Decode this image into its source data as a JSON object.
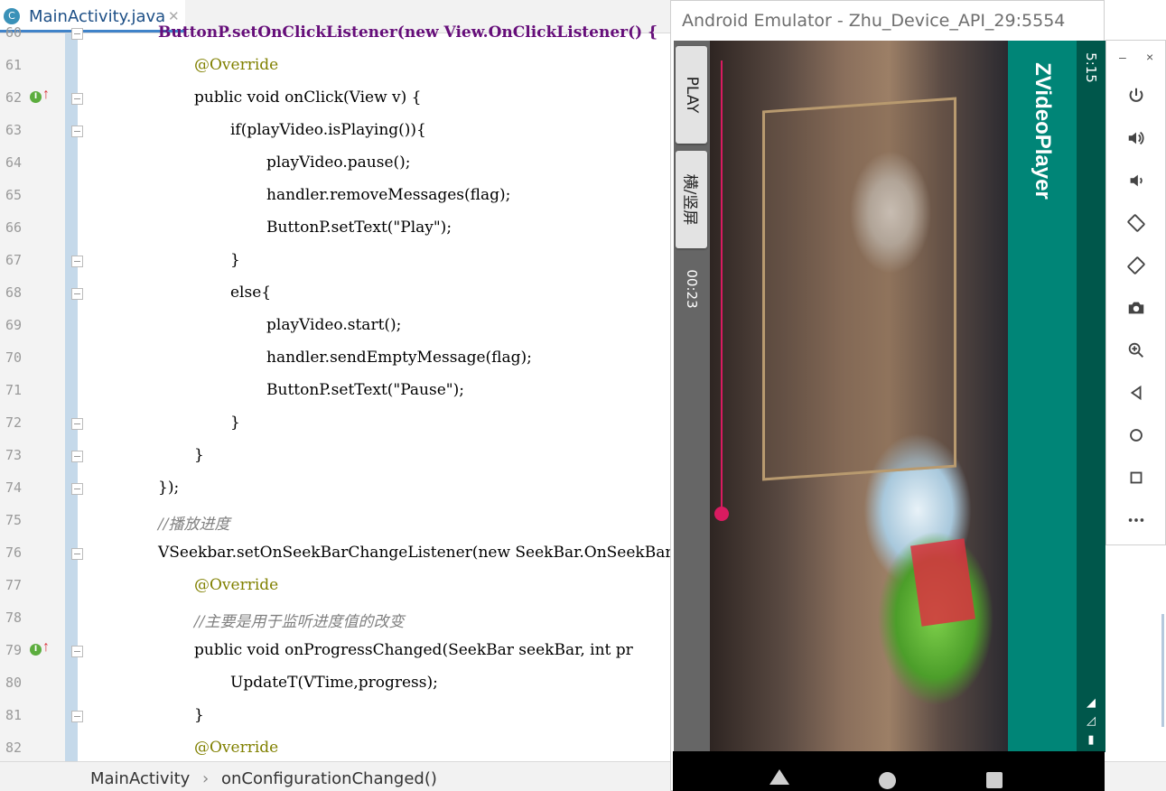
{
  "editor": {
    "tab": {
      "icon_letter": "C",
      "filename": "MainActivity.java",
      "close": "✕"
    },
    "lines": [
      {
        "num": "60",
        "text": "ButtonP.setOnClickListener(new View.OnClickListener() {"
      },
      {
        "num": "61",
        "text": "@Override"
      },
      {
        "num": "62",
        "text": "public void onClick(View v) {"
      },
      {
        "num": "63",
        "text": "if(playVideo.isPlaying()){"
      },
      {
        "num": "64",
        "text": "playVideo.pause();"
      },
      {
        "num": "65",
        "text": "handler.removeMessages(flag);"
      },
      {
        "num": "66",
        "text": "ButtonP.setText(\"Play\");"
      },
      {
        "num": "67",
        "text": "}"
      },
      {
        "num": "68",
        "text": "else{"
      },
      {
        "num": "69",
        "text": "playVideo.start();"
      },
      {
        "num": "70",
        "text": "handler.sendEmptyMessage(flag);"
      },
      {
        "num": "71",
        "text": "ButtonP.setText(\"Pause\");"
      },
      {
        "num": "72",
        "text": "}"
      },
      {
        "num": "73",
        "text": "}"
      },
      {
        "num": "74",
        "text": "});"
      },
      {
        "num": "75",
        "text": "//播放进度"
      },
      {
        "num": "76",
        "text": "VSeekbar.setOnSeekBarChangeListener(new SeekBar.OnSeekBar"
      },
      {
        "num": "77",
        "text": "@Override"
      },
      {
        "num": "78",
        "text": "//主要是用于监听进度值的改变"
      },
      {
        "num": "79",
        "text": "public void onProgressChanged(SeekBar seekBar, int pr"
      },
      {
        "num": "80",
        "text": "UpdateT(VTime,progress);"
      },
      {
        "num": "81",
        "text": "}"
      },
      {
        "num": "82",
        "text": "@Override"
      }
    ],
    "gutter_badge": "I",
    "breadcrumb": {
      "class_name": "MainActivity",
      "separator": "›",
      "method": "onConfigurationChanged()"
    }
  },
  "emulator": {
    "window_title": "Android Emulator - Zhu_Device_API_29:5554",
    "status_time": "5:15",
    "app_title": "ZVideoPlayer",
    "play_button": "PLAY",
    "rotate_button": "横/竖屏",
    "elapsed_time": "00:23",
    "seek_progress_fraction": 0.62,
    "accent_color": "#d81b60",
    "appbar_color": "#008577",
    "statusbar_color": "#00574b",
    "navbar_icons": [
      "back-icon",
      "home-icon",
      "recents-icon"
    ]
  },
  "toolbar": {
    "window_buttons": {
      "minimize": "–",
      "close": "×"
    },
    "buttons": [
      "power-icon",
      "volume-up-icon",
      "volume-down-icon",
      "rotate-left-icon",
      "rotate-right-icon",
      "camera-icon",
      "zoom-icon",
      "back-icon",
      "home-icon",
      "overview-icon",
      "more-icon"
    ]
  }
}
